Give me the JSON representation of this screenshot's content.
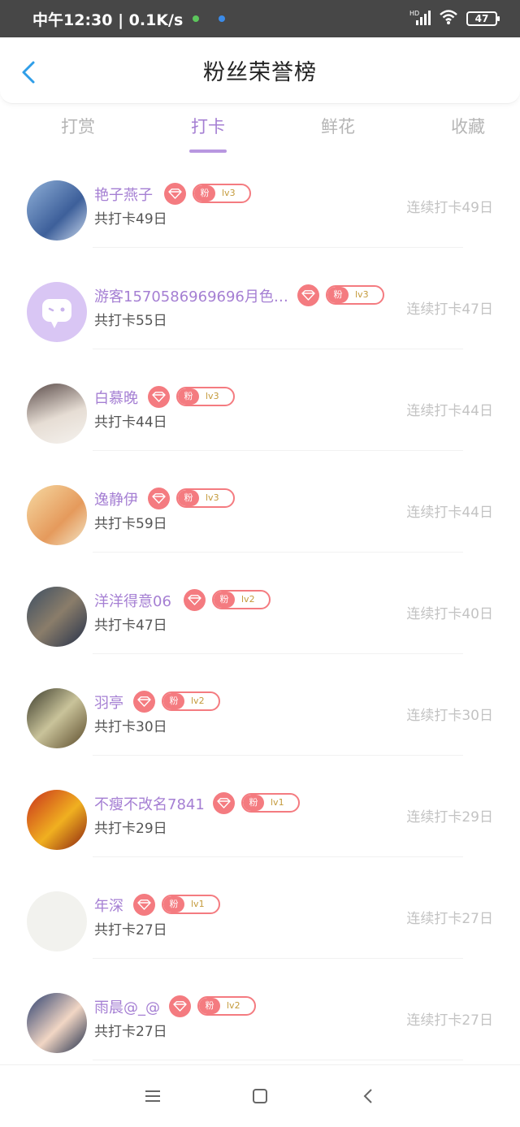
{
  "status": {
    "time": "中午12:30 | 0.1K/s",
    "network": "HD",
    "battery": "47"
  },
  "header": {
    "title": "粉丝荣誉榜"
  },
  "tabs": [
    {
      "label": "打赏",
      "active": false
    },
    {
      "label": "打卡",
      "active": true
    },
    {
      "label": "鲜花",
      "active": false
    },
    {
      "label": "收藏",
      "active": false
    }
  ],
  "badge_prefix": "粉",
  "users": [
    {
      "name": "艳子燕子",
      "level": "lv3",
      "total": "共打卡49日",
      "streak": "连续打卡49日"
    },
    {
      "name": "游客1570586969696月色…",
      "level": "lv3",
      "total": "共打卡55日",
      "streak": "连续打卡47日"
    },
    {
      "name": "白慕晚",
      "level": "lv3",
      "total": "共打卡44日",
      "streak": "连续打卡44日"
    },
    {
      "name": "逸静伊",
      "level": "lv3",
      "total": "共打卡59日",
      "streak": "连续打卡44日"
    },
    {
      "name": "洋洋得意06",
      "level": "lv2",
      "total": "共打卡47日",
      "streak": "连续打卡40日"
    },
    {
      "name": "羽亭",
      "level": "lv2",
      "total": "共打卡30日",
      "streak": "连续打卡30日"
    },
    {
      "name": "不瘦不改名7841",
      "level": "lv1",
      "total": "共打卡29日",
      "streak": "连续打卡29日"
    },
    {
      "name": "年深",
      "level": "lv1",
      "total": "共打卡27日",
      "streak": "连续打卡27日"
    },
    {
      "name": "雨晨@_@",
      "level": "lv2",
      "total": "共打卡27日",
      "streak": "连续打卡27日"
    }
  ],
  "colors": {
    "accent": "#a57fd3",
    "badge": "#f47b80",
    "status_bar": "#474747"
  }
}
